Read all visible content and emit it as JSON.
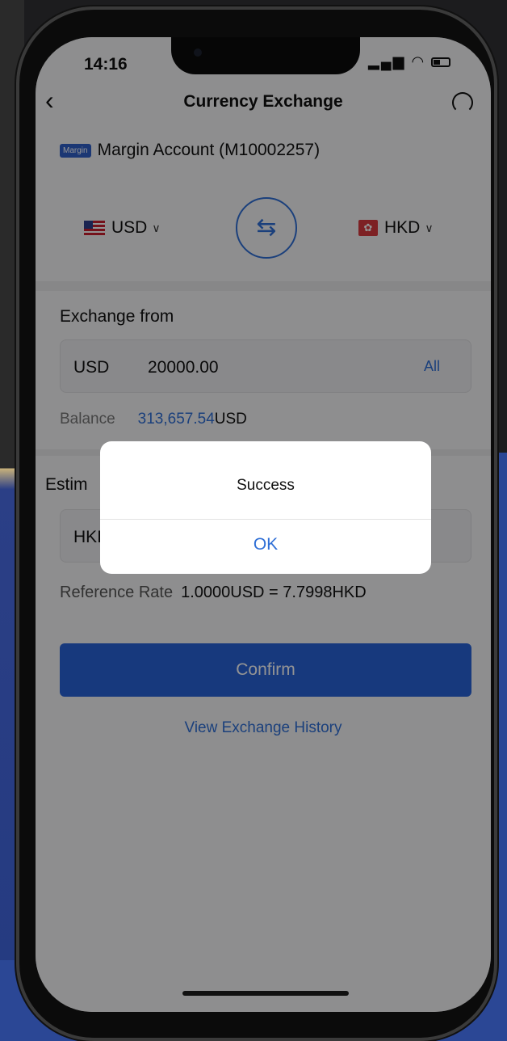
{
  "status_bar": {
    "time": "14:16"
  },
  "header": {
    "title": "Currency Exchange"
  },
  "account": {
    "badge": "Margin",
    "name": "Margin Account (M10002257)"
  },
  "currency": {
    "from": "USD",
    "to": "HKD",
    "swap_icon": "swap-arrows-icon"
  },
  "exchange_from": {
    "label": "Exchange from",
    "currency": "USD",
    "amount": "20000.00",
    "all_label": "All",
    "balance_label": "Balance",
    "balance_value": "313,657.54",
    "balance_currency": "USD"
  },
  "estimate": {
    "label": "Estim",
    "currency": "HKI"
  },
  "rate": {
    "label": "Reference Rate",
    "value": "1.0000USD = 7.7998HKD"
  },
  "actions": {
    "confirm_label": "Confirm",
    "history_label": "View Exchange History"
  },
  "dialog": {
    "message": "Success",
    "ok_label": "OK"
  },
  "colors": {
    "accent": "#2f6fd6",
    "button": "#2862d8",
    "badge": "#2f5fc8"
  }
}
